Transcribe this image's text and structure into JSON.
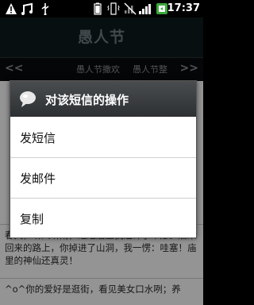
{
  "status_bar": {
    "time": "17:37",
    "icons": [
      "usb-icon",
      "warning-icon",
      "battery-icon",
      "vibrate-icon",
      "no-signal-icon",
      "signal-icon",
      "calendar-app-icon"
    ]
  },
  "header": {
    "title": "愚人节"
  },
  "tabs": {
    "prev_arrow": "<<",
    "next_arrow": ">>",
    "items": [
      "愚人节撒欢",
      "愚人节整"
    ]
  },
  "messages": [
    "春天，听风听雨，经过庙里我还许了个愿。后来回来的路上，你掉进了山洞，我一愣：哇塞！庙里的神仙还真灵！",
    "^o^你的爱好是逛街，看见美女口水咧；养"
  ],
  "dialog": {
    "title": "对该短信的操作",
    "icon": "chat-bubble-icon",
    "options": [
      "发短信",
      "发邮件",
      "复制"
    ]
  }
}
